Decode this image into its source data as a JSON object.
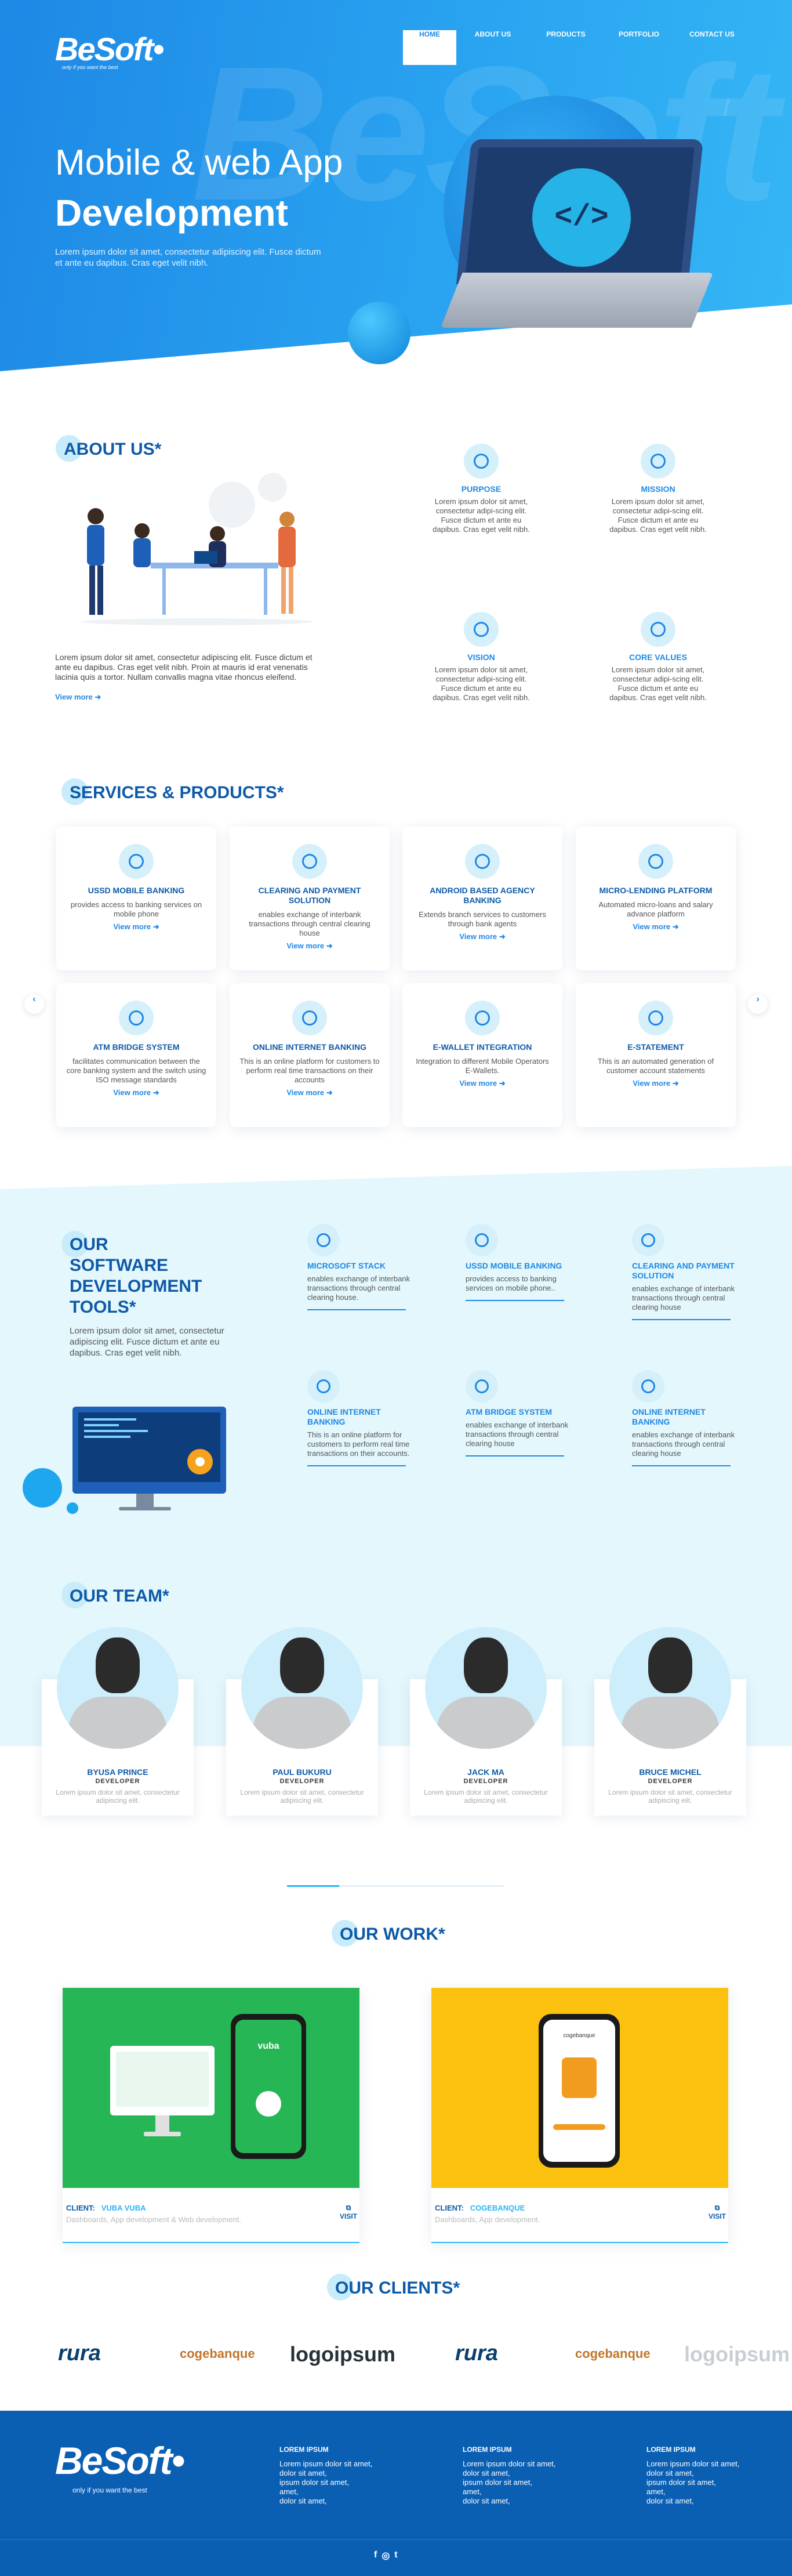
{
  "header": {
    "logo": "BeSoft",
    "logo_tag": "only if you want the best",
    "nav": [
      "HOME",
      "ABOUT US",
      "PRODUCTS",
      "PORTFOLIO",
      "CONTACT US"
    ]
  },
  "hero": {
    "title1": "Mobile & web App",
    "title2": "Development",
    "desc": "Lorem ipsum dolor sit amet, consectetur adipiscing elit. Fusce dictum et ante eu dapibus. Cras eget velit nibh.",
    "watermark": "BeSoft",
    "code_icon": "</>"
  },
  "about": {
    "heading": "ABOUT US*",
    "text": "Lorem ipsum dolor sit amet, consectetur adipiscing elit. Fusce dictum et ante eu dapibus. Cras eget velit nibh. Proin at mauris id erat venenatis lacinia quis a tortor. Nullam convallis magna vitae rhoncus eleifend.",
    "more": "View more",
    "features": [
      {
        "title": "PURPOSE",
        "text": "Lorem ipsum dolor sit amet, consectetur adipi-scing elit. Fusce dictum et ante eu dapibus. Cras eget velit nibh."
      },
      {
        "title": "MISSION",
        "text": "Lorem ipsum dolor sit amet, consectetur adipi-scing elit. Fusce dictum et ante eu dapibus. Cras eget velit nibh."
      },
      {
        "title": "VISION",
        "text": "Lorem ipsum dolor sit amet, consectetur adipi-scing elit. Fusce dictum et ante eu dapibus. Cras eget velit nibh."
      },
      {
        "title": "CORE VALUES",
        "text": "Lorem ipsum dolor sit amet, consectetur adipi-scing elit. Fusce dictum et ante eu dapibus. Cras eget velit nibh."
      }
    ]
  },
  "services": {
    "heading": "SERVICES & PRODUCTS*",
    "more": "View more",
    "prev": "‹",
    "next": "›",
    "cards": [
      {
        "title": "USSD MOBILE BANKING",
        "text": "provides access to banking services on mobile phone"
      },
      {
        "title": "CLEARING AND PAYMENT SOLUTION",
        "text": "enables exchange of interbank transactions through central clearing house"
      },
      {
        "title": "ANDROID BASED AGENCY BANKING",
        "text": "Extends branch services to customers through bank agents"
      },
      {
        "title": "MICRO-LENDING PLATFORM",
        "text": "Automated micro-loans and salary advance platform"
      },
      {
        "title": "ATM BRIDGE SYSTEM",
        "text": "facilitates communication between the core banking system and the switch using ISO message standards"
      },
      {
        "title": "ONLINE INTERNET BANKING",
        "text": "This is an online platform for customers to perform real time transactions on their accounts"
      },
      {
        "title": "E-WALLET INTEGRATION",
        "text": "Integration to different Mobile Operators E-Wallets."
      },
      {
        "title": "E-STATEMENT",
        "text": "This is an automated generation of customer account statements"
      }
    ]
  },
  "tools": {
    "heading": [
      "OUR",
      "SOFTWARE",
      "DEVELOPMENT",
      "TOOLS*"
    ],
    "text": "Lorem ipsum dolor sit amet, consectetur adipiscing elit. Fusce dictum et ante eu dapibus. Cras eget velit nibh.",
    "items": [
      {
        "title": "MICROSOFT STACK",
        "text": "enables exchange of interbank transactions through central clearing house."
      },
      {
        "title": "USSD MOBILE BANKING",
        "text": "provides access to banking services on mobile phone.."
      },
      {
        "title": "CLEARING AND PAYMENT SOLUTION",
        "text": "enables exchange of interbank transactions through central clearing house"
      },
      {
        "title": "ONLINE INTERNET BANKING",
        "text": "This is an online platform for customers to perform real time transactions on their accounts."
      },
      {
        "title": "ATM BRIDGE SYSTEM",
        "text": "enables exchange of interbank transactions through central clearing house"
      },
      {
        "title": "ONLINE INTERNET BANKING",
        "text": "enables exchange of interbank transactions through central clearing house"
      }
    ]
  },
  "team": {
    "heading": "OUR TEAM*",
    "members": [
      {
        "name": "BYUSA PRINCE",
        "role": "DEVELOPER",
        "text": "Lorem ipsum dolor sit amet, consectetur adipiscing elit."
      },
      {
        "name": "PAUL BUKURU",
        "role": "DEVELOPER",
        "text": "Lorem ipsum dolor sit amet, consectetur adipiscing elit."
      },
      {
        "name": "JACK MA",
        "role": "DEVELOPER",
        "text": "Lorem ipsum dolor sit amet, consectetur adipiscing elit."
      },
      {
        "name": "BRUCE MICHEL",
        "role": "DEVELOPER",
        "text": "Lorem ipsum dolor sit amet, consectetur adipiscing elit."
      }
    ]
  },
  "work": {
    "heading": "OUR WORK*",
    "items": [
      {
        "label": "CLIENT:",
        "client": "VUBA VUBA",
        "sub": "Dashboards, App development & Web development.",
        "visit": "VISIT",
        "app": "vuba"
      },
      {
        "label": "CLIENT:",
        "client": "COGEBANQUE",
        "sub": "Dashboards, App development.",
        "visit": "VISIT",
        "app": "cogebanque"
      }
    ]
  },
  "clients": {
    "heading": "OUR CLIENTS*",
    "logos": [
      "rura",
      "cogebanque",
      "logoipsum",
      "rura",
      "cogebanque",
      "logoipsum"
    ]
  },
  "footer": {
    "logo": "BeSoft",
    "tag": "only if you want the best",
    "columns": [
      {
        "title": "LOREM IPSUM",
        "items": [
          "Lorem ipsum dolor sit amet,",
          "dolor sit amet,",
          "ipsum dolor sit amet,",
          "amet,",
          "dolor sit amet,"
        ]
      },
      {
        "title": "LOREM IPSUM",
        "items": [
          "Lorem ipsum dolor sit amet,",
          "dolor sit amet,",
          "ipsum dolor sit amet,",
          "amet,",
          "dolor sit amet,"
        ]
      },
      {
        "title": "LOREM IPSUM",
        "items": [
          "Lorem ipsum dolor sit amet,",
          "dolor sit amet,",
          "ipsum dolor sit amet,",
          "amet,",
          "dolor sit amet,"
        ]
      }
    ],
    "social": [
      "f",
      "◎",
      "t"
    ]
  },
  "colors": {
    "primary": "#1e88e5",
    "dark": "#0e5aa8",
    "light": "#e4f7fc",
    "footer": "#0b5fb3"
  },
  "icons": [
    "code-icon",
    "target-icon",
    "binoculars-icon",
    "check-icon",
    "arrow-right-icon",
    "external-link-icon",
    "facebook-icon",
    "instagram-icon",
    "twitter-icon"
  ]
}
